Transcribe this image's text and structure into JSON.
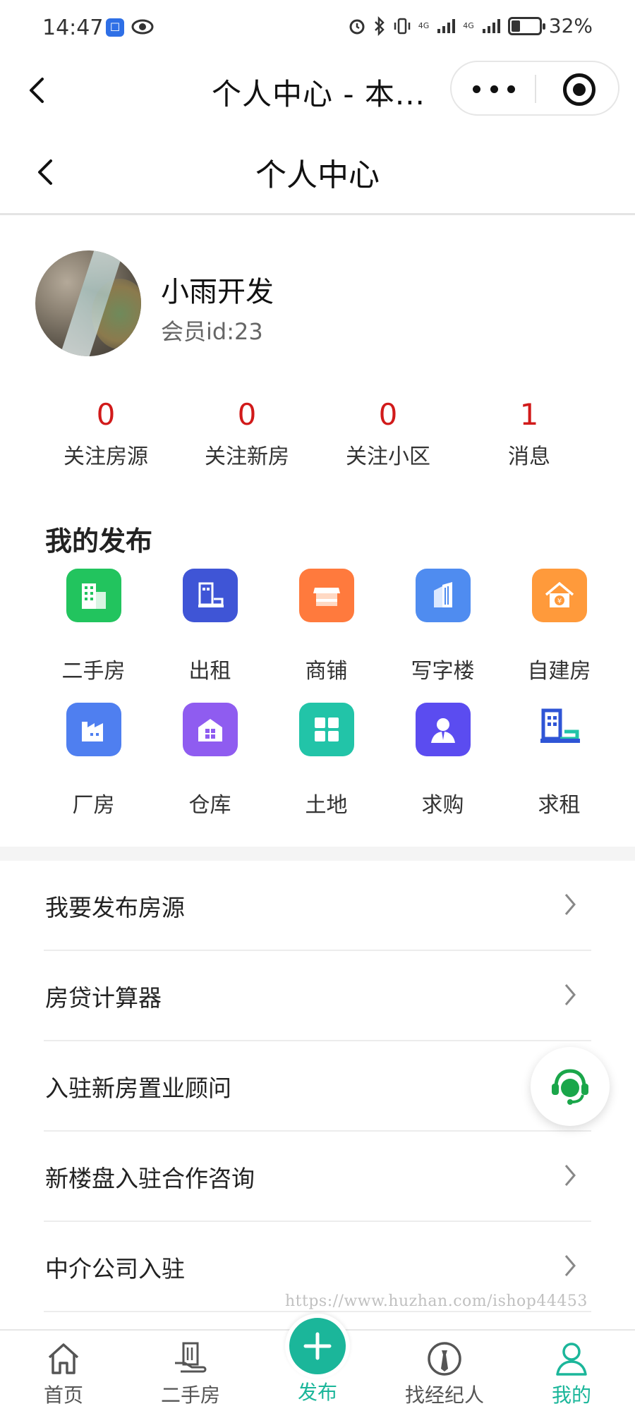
{
  "status_bar": {
    "time": "14:47",
    "signal1": "4G",
    "signal2": "4G",
    "battery_level": 0.32,
    "battery_text": "32%"
  },
  "mini_program": {
    "title": "个人中心 - 本...",
    "icons": [
      "back-icon",
      "more-icon",
      "close-icon"
    ]
  },
  "page": {
    "title": "个人中心"
  },
  "profile": {
    "name": "小雨开发",
    "member_id": "会员id:23"
  },
  "stats": [
    {
      "value": "0",
      "label": "关注房源"
    },
    {
      "value": "0",
      "label": "关注新房"
    },
    {
      "value": "0",
      "label": "关注小区"
    },
    {
      "value": "1",
      "label": "消息"
    }
  ],
  "publish": {
    "title": "我的发布",
    "items": [
      {
        "label": "二手房",
        "icon": "building-icon",
        "color": "#22c45e"
      },
      {
        "label": "出租",
        "icon": "rent-icon",
        "color": "#3f55d6"
      },
      {
        "label": "商铺",
        "icon": "shop-icon",
        "color": "#ff7a3d"
      },
      {
        "label": "写字楼",
        "icon": "office-icon",
        "color": "#4f8cf0"
      },
      {
        "label": "自建房",
        "icon": "house-icon",
        "color": "#ff9a3b"
      },
      {
        "label": "厂房",
        "icon": "factory-icon",
        "color": "#4f7ff0"
      },
      {
        "label": "仓库",
        "icon": "warehouse-icon",
        "color": "#8f5cf0"
      },
      {
        "label": "土地",
        "icon": "land-icon",
        "color": "#22c4a8"
      },
      {
        "label": "求购",
        "icon": "buyer-icon",
        "color": "#5b4cf0"
      },
      {
        "label": "求租",
        "icon": "tenant-icon",
        "color": "#2f55d6"
      }
    ]
  },
  "menu": [
    {
      "label": "我要发布房源"
    },
    {
      "label": "房贷计算器"
    },
    {
      "label": "入驻新房置业顾问"
    },
    {
      "label": "新楼盘入驻合作咨询"
    },
    {
      "label": "中介公司入驻"
    }
  ],
  "watermark": "https://www.huzhan.com/ishop44453",
  "tabbar": {
    "items": [
      {
        "label": "首页",
        "icon": "home-icon"
      },
      {
        "label": "二手房",
        "icon": "secondhand-house-icon"
      },
      {
        "label": "发布",
        "icon": "plus-icon"
      },
      {
        "label": "找经纪人",
        "icon": "agent-icon"
      },
      {
        "label": "我的",
        "icon": "user-icon"
      }
    ],
    "active_color": "#1bb69a"
  }
}
